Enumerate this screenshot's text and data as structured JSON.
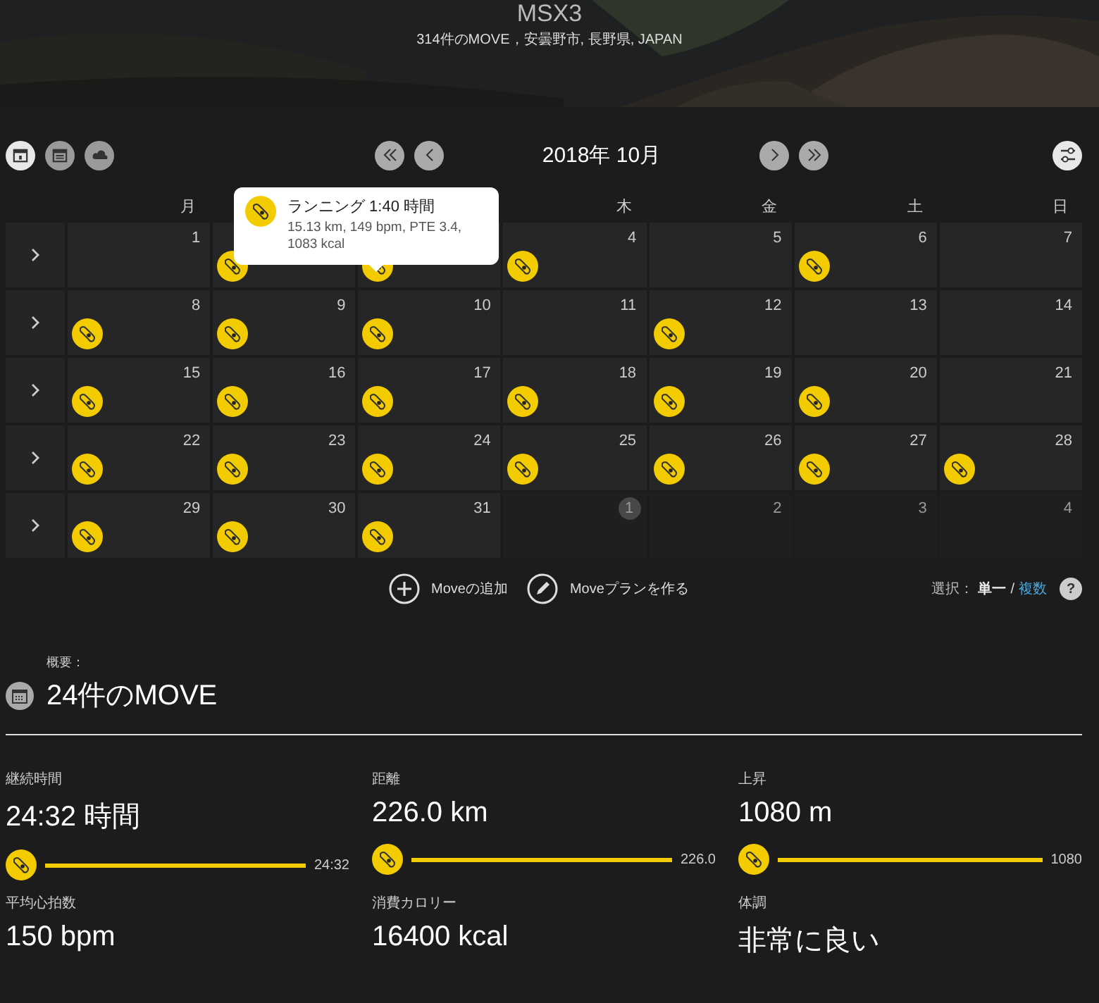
{
  "header": {
    "title": "MSX3",
    "subtitle": "314件のMOVE，安曇野市, 長野県, JAPAN"
  },
  "toolbar": {
    "views": [
      {
        "kind": "calendar",
        "selected": true
      },
      {
        "kind": "list",
        "selected": false
      },
      {
        "kind": "cloud",
        "selected": false
      }
    ],
    "month": "2018年 10月"
  },
  "calendar": {
    "weekdays": {
      "before_tooltip": [
        "月"
      ],
      "after_tooltip": [
        "木",
        "金",
        "土",
        "日"
      ]
    },
    "weeks": [
      {
        "days": [
          {
            "day": "1",
            "move": false,
            "other_month": false
          },
          {
            "move": true,
            "other_month": false
          },
          {
            "move": true,
            "other_month": false
          },
          {
            "day": "4",
            "move": true,
            "other_month": false
          },
          {
            "day": "5",
            "move": false,
            "other_month": false
          },
          {
            "day": "6",
            "move": true,
            "other_month": false
          },
          {
            "day": "7",
            "move": false,
            "other_month": false
          }
        ]
      },
      {
        "days": [
          {
            "day": "8",
            "move": true,
            "other_month": false
          },
          {
            "day": "9",
            "move": true,
            "other_month": false
          },
          {
            "day": "10",
            "move": true,
            "other_month": false
          },
          {
            "day": "11",
            "move": false,
            "other_month": false
          },
          {
            "day": "12",
            "move": true,
            "other_month": false
          },
          {
            "day": "13",
            "move": false,
            "other_month": false
          },
          {
            "day": "14",
            "move": false,
            "other_month": false
          }
        ]
      },
      {
        "days": [
          {
            "day": "15",
            "move": true,
            "other_month": false
          },
          {
            "day": "16",
            "move": true,
            "other_month": false
          },
          {
            "day": "17",
            "move": true,
            "other_month": false
          },
          {
            "day": "18",
            "move": true,
            "other_month": false
          },
          {
            "day": "19",
            "move": true,
            "other_month": false
          },
          {
            "day": "20",
            "move": true,
            "other_month": false
          },
          {
            "day": "21",
            "move": false,
            "other_month": false
          }
        ]
      },
      {
        "days": [
          {
            "day": "22",
            "move": true,
            "other_month": false
          },
          {
            "day": "23",
            "move": true,
            "other_month": false
          },
          {
            "day": "24",
            "move": true,
            "other_month": false
          },
          {
            "day": "25",
            "move": true,
            "other_month": false
          },
          {
            "day": "26",
            "move": true,
            "other_month": false
          },
          {
            "day": "27",
            "move": true,
            "other_month": false
          },
          {
            "day": "28",
            "move": true,
            "other_month": false
          }
        ]
      },
      {
        "days": [
          {
            "day": "29",
            "move": true,
            "other_month": false
          },
          {
            "day": "30",
            "move": true,
            "other_month": false
          },
          {
            "day": "31",
            "move": true,
            "other_month": false
          },
          {
            "day": "1",
            "move": false,
            "other_month": true,
            "today": true
          },
          {
            "day": "2",
            "move": false,
            "other_month": true
          },
          {
            "day": "3",
            "move": false,
            "other_month": true
          },
          {
            "day": "4",
            "move": false,
            "other_month": true
          }
        ]
      }
    ],
    "tooltip": {
      "title": "ランニング 1:40 時間",
      "detail": "15.13 km, 149 bpm, PTE 3.4, 1083 kcal"
    }
  },
  "actions": [
    "Moveの追加",
    "Moveプランを作る"
  ],
  "selection": {
    "label": "選択：",
    "options": [
      {
        "label": "単一",
        "selected": true
      },
      {
        "label": "複数",
        "selected": false
      }
    ],
    "separator": "/",
    "help": "?"
  },
  "summary": {
    "label": "概要：",
    "title": "24件のMOVE",
    "stats": [
      {
        "kind": "bar",
        "label": "継続時間",
        "value": "24:32 時間",
        "level": 1,
        "reading": "24:32"
      },
      {
        "kind": "bar",
        "label": "距離",
        "value": "226.0 km",
        "level": 1,
        "reading": "226.0"
      },
      {
        "kind": "bar",
        "label": "上昇",
        "value": "1080 m",
        "level": 1,
        "reading": "1080"
      },
      {
        "kind": "plain",
        "label": "平均心拍数",
        "value": "150 bpm"
      },
      {
        "kind": "plain",
        "label": "消費カロリー",
        "value": "16400 kcal"
      },
      {
        "kind": "plain",
        "label": "体調",
        "value": "非常に良い"
      }
    ]
  }
}
